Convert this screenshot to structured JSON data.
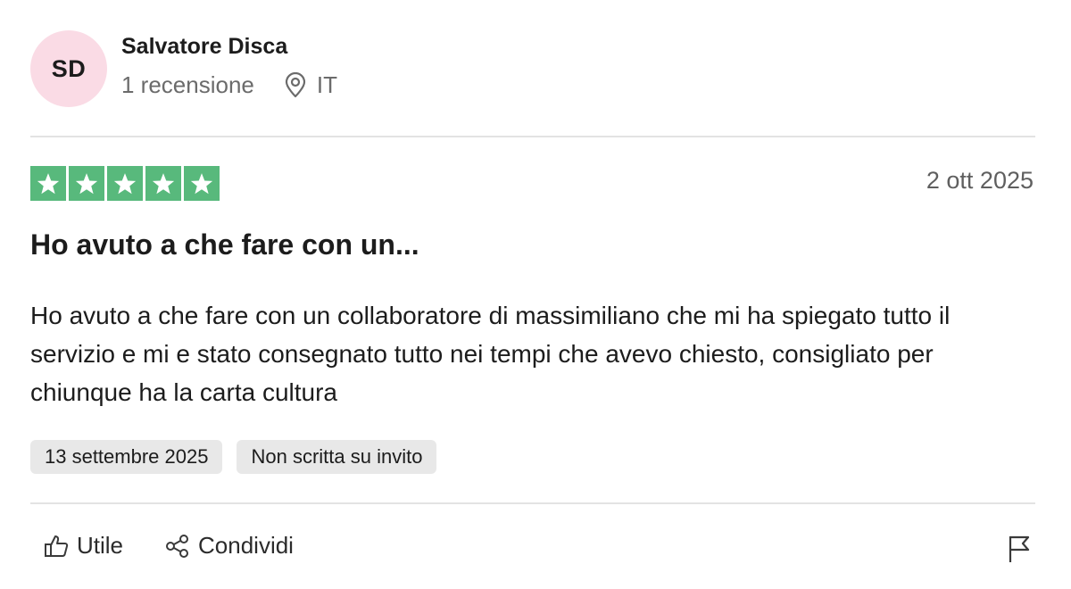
{
  "reviewer": {
    "initials": "SD",
    "name": "Salvatore Disca",
    "review_count": "1 recensione",
    "country": "IT",
    "location_icon": "location-pin-icon"
  },
  "review": {
    "rating": 5,
    "rating_max": 5,
    "star_color": "#58b97c",
    "date": "2 ott 2025",
    "title": "Ho avuto a che fare con un...",
    "body": "Ho avuto a che fare con un collaboratore di massimiliano che mi ha spiegato tutto il servizio e mi e stato consegnato tutto nei tempi che avevo chiesto, consigliato per chiunque ha la carta cultura",
    "tags": [
      "13 settembre 2025",
      "Non scritta su invito"
    ]
  },
  "actions": {
    "useful_label": "Utile",
    "useful_icon": "thumbs-up-icon",
    "share_label": "Condividi",
    "share_icon": "share-icon",
    "report_icon": "flag-icon"
  }
}
